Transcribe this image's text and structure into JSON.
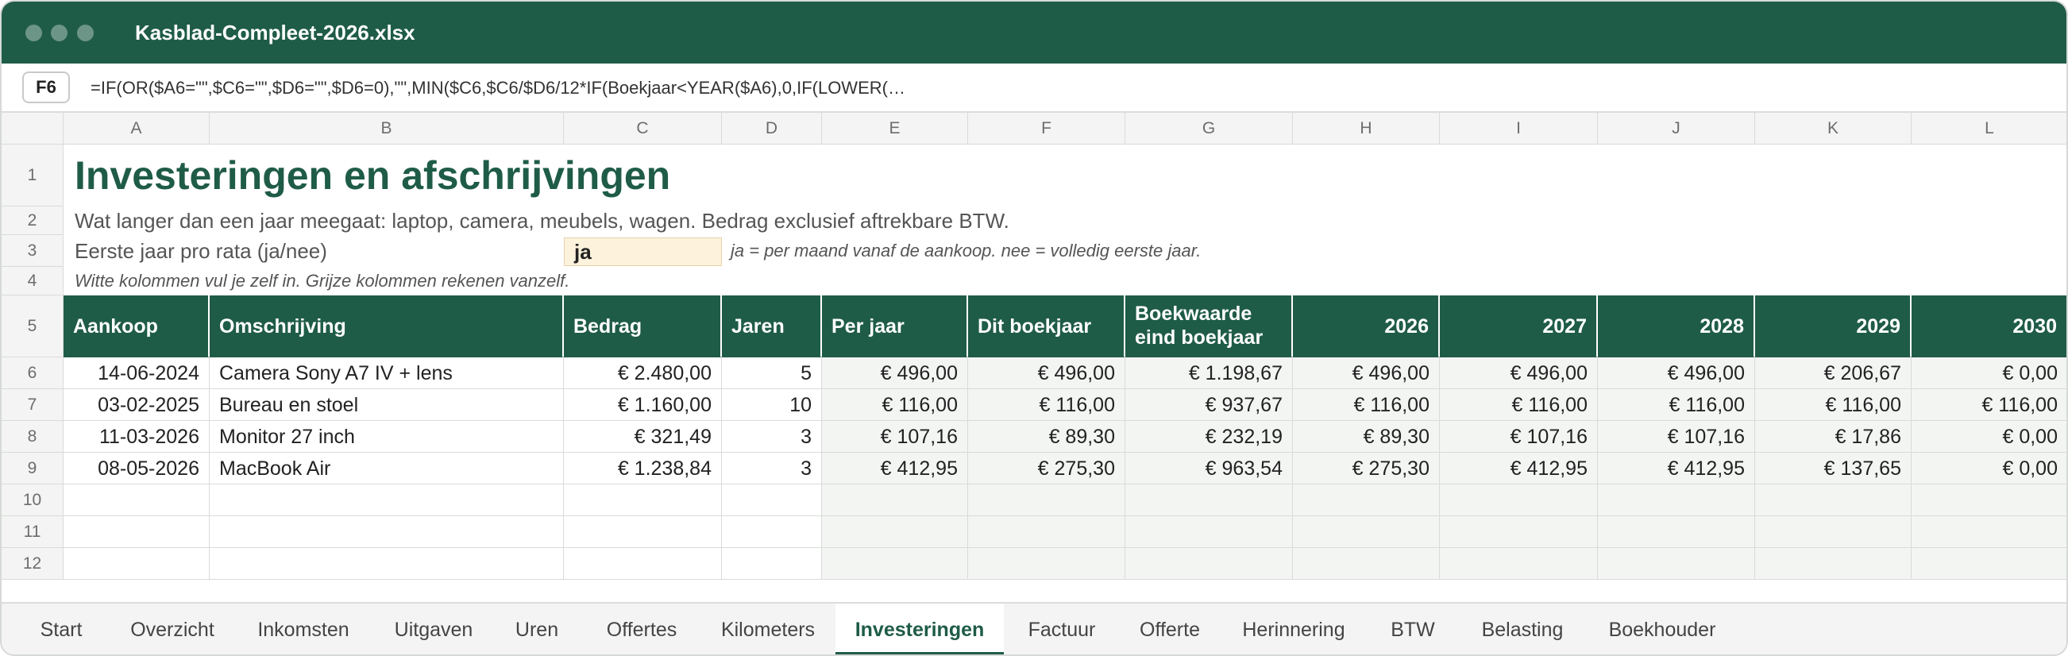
{
  "window": {
    "title": "Kasblad-Compleet-2026.xlsx"
  },
  "formula_bar": {
    "cell_ref": "F6",
    "formula": "=IF(OR($A6=\"\",$C6=\"\",$D6=\"\",$D6=0),\"\",MIN($C6,$C6/$D6/12*IF(Boekjaar<YEAR($A6),0,IF(LOWER(…"
  },
  "columns": [
    "A",
    "B",
    "C",
    "D",
    "E",
    "F",
    "G",
    "H",
    "I",
    "J",
    "K",
    "L"
  ],
  "rows": [
    "1",
    "2",
    "3",
    "4",
    "5",
    "6",
    "7",
    "8",
    "9",
    "10",
    "11",
    "12"
  ],
  "sheet": {
    "title": "Investeringen en afschrijvingen",
    "subtitle": "Wat langer dan een jaar meegaat: laptop, camera, meubels, wagen. Bedrag exclusief aftrekbare BTW.",
    "prorata_label": "Eerste jaar pro rata (ja/nee)",
    "prorata_value": "ja",
    "prorata_note": "ja = per maand vanaf de aankoop. nee = volledig eerste jaar.",
    "hint": "Witte kolommen vul je zelf in. Grijze kolommen rekenen vanzelf."
  },
  "table": {
    "headers": {
      "aankoop": "Aankoop",
      "omschrijving": "Omschrijving",
      "bedrag": "Bedrag",
      "jaren": "Jaren",
      "per_jaar": "Per jaar",
      "dit_boekjaar": "Dit boekjaar",
      "boekwaarde_1": "Boekwaarde",
      "boekwaarde_2": "eind boekjaar",
      "y2026": "2026",
      "y2027": "2027",
      "y2028": "2028",
      "y2029": "2029",
      "y2030": "2030"
    },
    "rows": [
      [
        "14-06-2024",
        "Camera Sony A7 IV + lens",
        "€ 2.480,00",
        "5",
        "€ 496,00",
        "€ 496,00",
        "€ 1.198,67",
        "€ 496,00",
        "€ 496,00",
        "€ 496,00",
        "€ 206,67",
        "€ 0,00"
      ],
      [
        "03-02-2025",
        "Bureau en stoel",
        "€ 1.160,00",
        "10",
        "€ 116,00",
        "€ 116,00",
        "€ 937,67",
        "€ 116,00",
        "€ 116,00",
        "€ 116,00",
        "€ 116,00",
        "€ 116,00"
      ],
      [
        "11-03-2026",
        "Monitor 27 inch",
        "€ 321,49",
        "3",
        "€ 107,16",
        "€ 89,30",
        "€ 232,19",
        "€ 89,30",
        "€ 107,16",
        "€ 107,16",
        "€ 17,86",
        "€ 0,00"
      ],
      [
        "08-05-2026",
        "MacBook Air",
        "€ 1.238,84",
        "3",
        "€ 412,95",
        "€ 275,30",
        "€ 963,54",
        "€ 275,30",
        "€ 412,95",
        "€ 412,95",
        "€ 137,65",
        "€ 0,00"
      ],
      [
        "",
        "",
        "",
        "",
        "",
        "",
        "",
        "",
        "",
        "",
        "",
        ""
      ],
      [
        "",
        "",
        "",
        "",
        "",
        "",
        "",
        "",
        "",
        "",
        "",
        ""
      ],
      [
        "",
        "",
        "",
        "",
        "",
        "",
        "",
        "",
        "",
        "",
        "",
        ""
      ]
    ]
  },
  "tabs": [
    "Start",
    "Overzicht",
    "Inkomsten",
    "Uitgaven",
    "Uren",
    "Offertes",
    "Kilometers",
    "Investeringen",
    "Factuur",
    "Offerte",
    "Herinnering",
    "BTW",
    "Belasting",
    "Boekhouder"
  ],
  "active_tab": "Investeringen",
  "colors": {
    "brand": "#1f5c47",
    "input_fill": "#fdf2dc",
    "computed_fill": "#f3f5f3"
  }
}
